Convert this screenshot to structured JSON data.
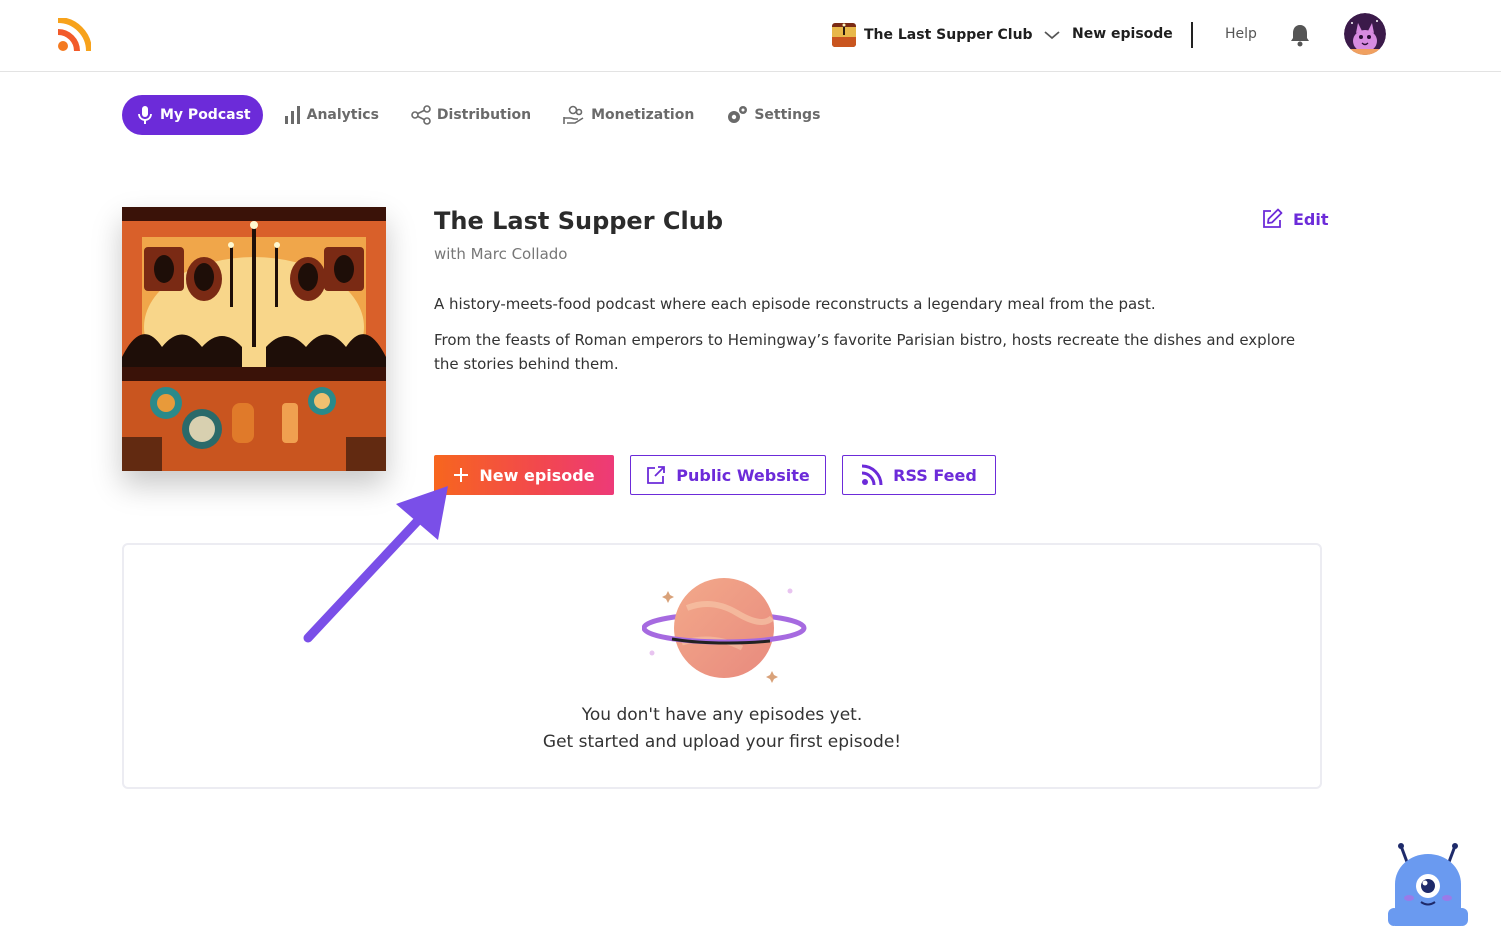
{
  "topbar": {
    "logo_icon": "rss-logo-icon",
    "podcast_name": "The Last Supper Club",
    "new_episode_label": "New episode",
    "help_label": "Help",
    "brand_color": "#f47a20"
  },
  "nav": {
    "tabs": [
      {
        "label": "My Podcast",
        "icon": "microphone-icon",
        "active": true
      },
      {
        "label": "Analytics",
        "icon": "bar-chart-icon",
        "active": false
      },
      {
        "label": "Distribution",
        "icon": "share-icon",
        "active": false
      },
      {
        "label": "Monetization",
        "icon": "hand-coin-icon",
        "active": false
      },
      {
        "label": "Settings",
        "icon": "gears-icon",
        "active": false
      }
    ],
    "active_color": "#6c2bd9"
  },
  "podcast": {
    "title": "The Last Supper Club",
    "host": "with Marc Collado",
    "description_1": "A history-meets-food podcast where each episode reconstructs a legendary meal from the past.",
    "description_2": "From the feasts of Roman emperors to Hemingway’s favorite Parisian bistro, hosts recreate the dishes and explore the stories behind them.",
    "edit_label": "Edit"
  },
  "actions": {
    "new_episode_label": "New episode",
    "public_website_label": "Public Website",
    "rss_feed_label": "RSS Feed"
  },
  "empty_state": {
    "line1": "You don't have any episodes yet.",
    "line2": "Get started and upload your first episode!"
  }
}
